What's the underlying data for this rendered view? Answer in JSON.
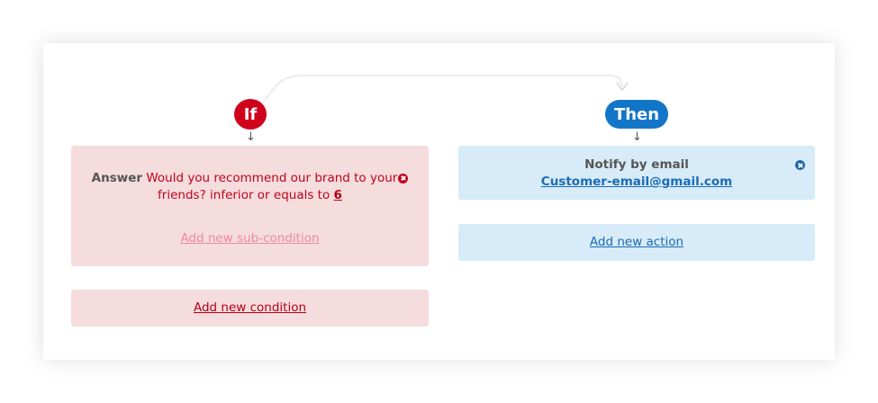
{
  "badges": {
    "if_label": "If",
    "then_label": "Then"
  },
  "condition": {
    "answer_label": "Answer",
    "question_text": "Would you recommend our brand to your",
    "question_text_2": "friends? inferior or equals to",
    "value": "6",
    "add_sub_condition_label": "Add new sub-condition"
  },
  "add_condition": {
    "label": "Add new condition"
  },
  "action": {
    "title": "Notify by email",
    "email": "Customer-email@gmail.com"
  },
  "add_action": {
    "label": "Add new action"
  },
  "icons": {
    "remove": "remove-icon",
    "arrow": "arrow-down-icon"
  },
  "colors": {
    "if_badge": "#d0021b",
    "then_badge": "#1276c8",
    "condition_bg": "#f5dcdd",
    "action_bg": "#d7ebf8",
    "link_red": "#b40016",
    "link_blue": "#1b6cb3"
  }
}
